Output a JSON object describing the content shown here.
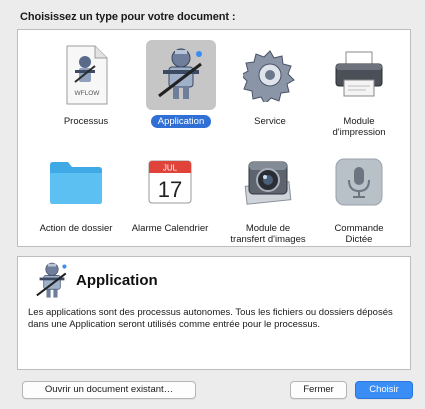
{
  "prompt": "Choisissez un type pour votre document :",
  "tiles": [
    {
      "label": "Processus",
      "icon": "workflow-file-icon",
      "badge": "WFLOW",
      "selected": false
    },
    {
      "label": "Application",
      "icon": "automator-robot-icon",
      "selected": true
    },
    {
      "label": "Service",
      "icon": "gear-icon",
      "selected": false
    },
    {
      "label": "Module\nd'impression",
      "icon": "printer-icon",
      "selected": false
    },
    {
      "label": "Action de dossier",
      "icon": "folder-icon",
      "selected": false
    },
    {
      "label": "Alarme Calendrier",
      "icon": "calendar-icon",
      "month": "JUL",
      "day": "17",
      "selected": false
    },
    {
      "label": "Module de\ntransfert d'images",
      "icon": "camera-icon",
      "selected": false
    },
    {
      "label": "Commande\nDictée",
      "icon": "microphone-icon",
      "selected": false
    }
  ],
  "description": {
    "title": "Application",
    "icon": "automator-robot-icon",
    "text": "Les applications sont des processus autonomes. Tous les fichiers ou dossiers déposés dans une Application seront utilisés comme entrée pour le processus."
  },
  "buttons": {
    "open": "Ouvrir un document existant…",
    "close": "Fermer",
    "choose": "Choisir"
  },
  "colors": {
    "accent": "#3a8df5",
    "selection": "#2f6fd6",
    "folder": "#4bb5ee",
    "calendar_red": "#e0433a"
  }
}
